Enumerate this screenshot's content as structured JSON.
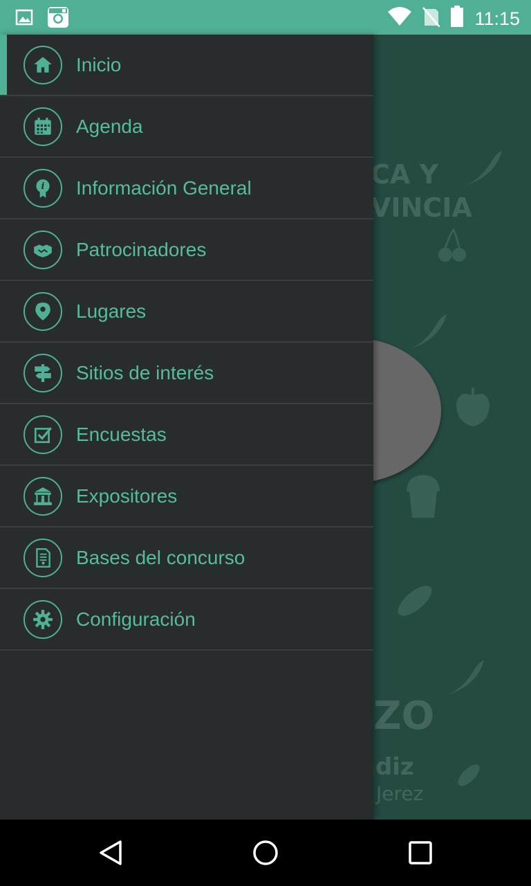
{
  "status_bar": {
    "time": "11:15",
    "icons": [
      "image-icon",
      "instagram-icon",
      "wifi-icon",
      "no-signal-icon",
      "battery-icon"
    ]
  },
  "background": {
    "text_line1": "CA Y",
    "text_line2": "VINCIA",
    "text_big": "ZO",
    "text_sub1": "ádiz",
    "text_sub2": "Jerez"
  },
  "menu": {
    "items": [
      {
        "label": "Inicio",
        "icon": "home-icon",
        "active": true
      },
      {
        "label": "Agenda",
        "icon": "calendar-icon",
        "active": false
      },
      {
        "label": "Información General",
        "icon": "info-icon",
        "active": false
      },
      {
        "label": "Patrocinadores",
        "icon": "handshake-icon",
        "active": false
      },
      {
        "label": "Lugares",
        "icon": "location-pin-icon",
        "active": false
      },
      {
        "label": "Sitios de interés",
        "icon": "signpost-icon",
        "active": false
      },
      {
        "label": "Encuestas",
        "icon": "checkbox-icon",
        "active": false
      },
      {
        "label": "Expositores",
        "icon": "stand-icon",
        "active": false
      },
      {
        "label": "Bases del concurso",
        "icon": "document-icon",
        "active": false
      },
      {
        "label": "Configuración",
        "icon": "gear-icon",
        "active": false
      }
    ]
  },
  "nav_bar": {
    "buttons": [
      "back-icon",
      "home-circle-icon",
      "recents-icon"
    ]
  },
  "colors": {
    "accent": "#4fb096",
    "drawer_bg": "#292c2c",
    "app_bg": "#244a42"
  }
}
